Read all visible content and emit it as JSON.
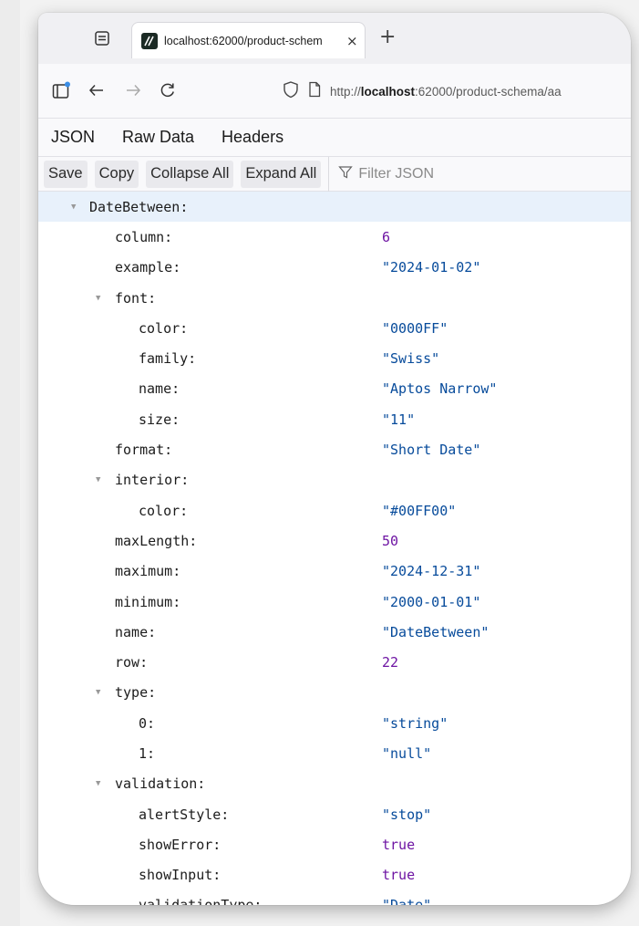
{
  "browser": {
    "tab_title": "localhost:62000/product-schem",
    "tab_close": "×",
    "new_tab": "+",
    "url_prefix": "http://",
    "url_host": "localhost",
    "url_rest": ":62000/product-schema/aa"
  },
  "viewer_tabs": [
    "JSON",
    "Raw Data",
    "Headers"
  ],
  "toolbar": {
    "save": "Save",
    "copy": "Copy",
    "collapse_all": "Collapse All",
    "expand_all": "Expand All",
    "filter_placeholder": "Filter JSON"
  },
  "tree": [
    {
      "indent": 0,
      "key": "DateBetween:",
      "twisty": "▼",
      "selected": true
    },
    {
      "indent": 1,
      "key": "column:",
      "value": "6",
      "type": "num"
    },
    {
      "indent": 1,
      "key": "example:",
      "value": "\"2024-01-02\"",
      "type": "str"
    },
    {
      "indent": 1,
      "key": "font:",
      "twisty": "▼"
    },
    {
      "indent": 2,
      "key": "color:",
      "value": "\"0000FF\"",
      "type": "str"
    },
    {
      "indent": 2,
      "key": "family:",
      "value": "\"Swiss\"",
      "type": "str"
    },
    {
      "indent": 2,
      "key": "name:",
      "value": "\"Aptos Narrow\"",
      "type": "str"
    },
    {
      "indent": 2,
      "key": "size:",
      "value": "\"11\"",
      "type": "str"
    },
    {
      "indent": 1,
      "key": "format:",
      "value": "\"Short Date\"",
      "type": "str"
    },
    {
      "indent": 1,
      "key": "interior:",
      "twisty": "▼"
    },
    {
      "indent": 2,
      "key": "color:",
      "value": "\"#00FF00\"",
      "type": "str"
    },
    {
      "indent": 1,
      "key": "maxLength:",
      "value": "50",
      "type": "num"
    },
    {
      "indent": 1,
      "key": "maximum:",
      "value": "\"2024-12-31\"",
      "type": "str"
    },
    {
      "indent": 1,
      "key": "minimum:",
      "value": "\"2000-01-01\"",
      "type": "str"
    },
    {
      "indent": 1,
      "key": "name:",
      "value": "\"DateBetween\"",
      "type": "str"
    },
    {
      "indent": 1,
      "key": "row:",
      "value": "22",
      "type": "num"
    },
    {
      "indent": 1,
      "key": "type:",
      "twisty": "▼"
    },
    {
      "indent": 2,
      "key": "0:",
      "value": "\"string\"",
      "type": "str"
    },
    {
      "indent": 2,
      "key": "1:",
      "value": "\"null\"",
      "type": "str"
    },
    {
      "indent": 1,
      "key": "validation:",
      "twisty": "▼"
    },
    {
      "indent": 2,
      "key": "alertStyle:",
      "value": "\"stop\"",
      "type": "str"
    },
    {
      "indent": 2,
      "key": "showError:",
      "value": "true",
      "type": "bool"
    },
    {
      "indent": 2,
      "key": "showInput:",
      "value": "true",
      "type": "bool"
    },
    {
      "indent": 2,
      "key": "validationType:",
      "value": "\"Date\"",
      "type": "str"
    }
  ],
  "colors": {
    "string": "#074b9b",
    "number": "#6e14a3",
    "selected_row": "#e8f1fb",
    "active_tab_accent": "#2b7bd3"
  }
}
